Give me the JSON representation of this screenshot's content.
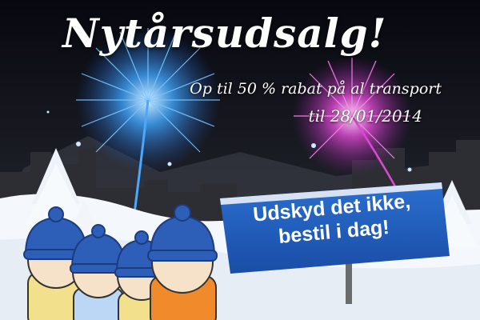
{
  "banner": {
    "headline": "Nytårsudsalg!",
    "subline_1": "Op til 50 % rabat på al transport",
    "subline_2": "til 28/01/2014",
    "sign_line_1": "Udskyd det ikke,",
    "sign_line_2": "bestil i dag!"
  },
  "colors": {
    "sky_top": "#0b0d18",
    "sky_bottom": "#2a2d36",
    "firework_blue": "#3fa6ff",
    "firework_pink": "#e24bd6",
    "sign_blue": "#1d57b5",
    "hat_blue": "#2e5fb8",
    "snow": "#f4f7fb"
  },
  "icons": [
    "firework-blue-icon",
    "firework-pink-icon",
    "snowy-tree-icon",
    "signpost-icon",
    "people-with-hats-icon"
  ]
}
